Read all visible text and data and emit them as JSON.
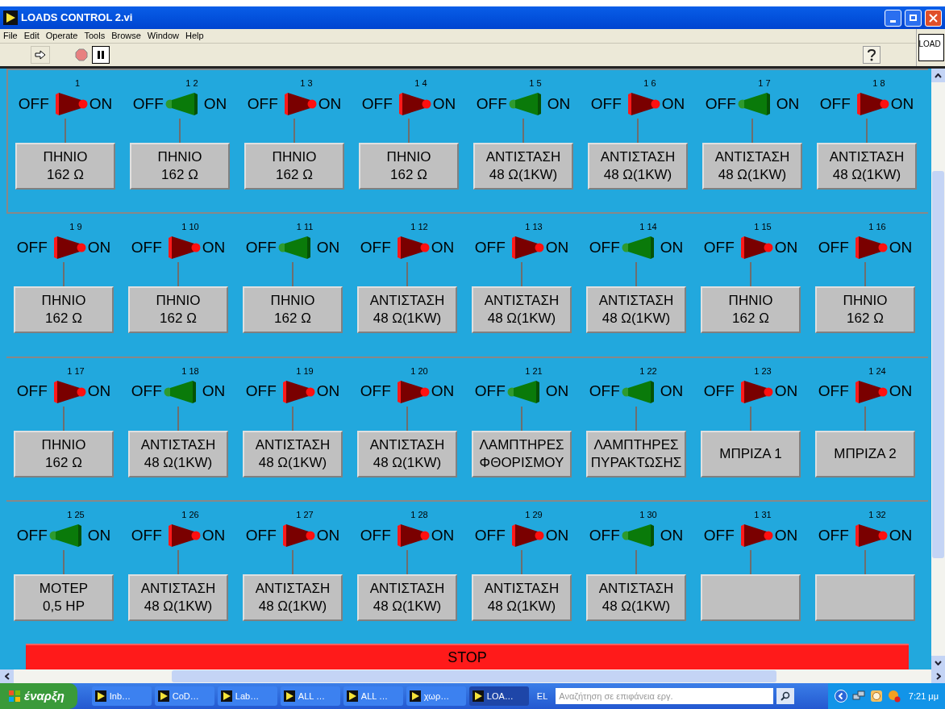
{
  "window": {
    "title": "LOADS CONTROL 2.vi"
  },
  "menu": [
    "File",
    "Edit",
    "Operate",
    "Tools",
    "Browse",
    "Window",
    "Help"
  ],
  "vi_icon": {
    "text": "LOAD"
  },
  "rows": [
    {
      "switches": [
        {
          "number": "1",
          "on": false,
          "off_label": "OFF",
          "on_label": "ON",
          "button": {
            "kind": "text",
            "lines": [
              "ΠΗΝΙΟ",
              "162 Ω"
            ]
          }
        },
        {
          "number": "1 2",
          "on": true,
          "off_label": "OFF",
          "on_label": "ON",
          "button": {
            "kind": "text",
            "lines": [
              "ΠΗΝΙΟ",
              "162 Ω"
            ]
          }
        },
        {
          "number": "1 3",
          "on": false,
          "off_label": "OFF",
          "on_label": "ON",
          "button": {
            "kind": "text",
            "lines": [
              "ΠΗΝΙΟ",
              "162 Ω"
            ]
          }
        },
        {
          "number": "1 4",
          "on": false,
          "off_label": "OFF",
          "on_label": "ON",
          "button": {
            "kind": "text",
            "lines": [
              "ΠΗΝΙΟ",
              "162 Ω"
            ]
          }
        },
        {
          "number": "1 5",
          "on": true,
          "off_label": "OFF",
          "on_label": "ON",
          "button": {
            "kind": "text",
            "lines": [
              "ΑΝΤΙΣΤΑΣΗ",
              "48 Ω(1KW)"
            ]
          }
        },
        {
          "number": "1 6",
          "on": false,
          "off_label": "OFF",
          "on_label": "ON",
          "button": {
            "kind": "text",
            "lines": [
              "ΑΝΤΙΣΤΑΣΗ",
              "48 Ω(1KW)"
            ]
          }
        },
        {
          "number": "1 7",
          "on": true,
          "off_label": "OFF",
          "on_label": "ON",
          "button": {
            "kind": "text",
            "lines": [
              "ΑΝΤΙΣΤΑΣΗ",
              "48 Ω(1KW)"
            ]
          }
        },
        {
          "number": "1 8",
          "on": false,
          "off_label": "OFF",
          "on_label": "ON",
          "button": {
            "kind": "text",
            "lines": [
              "ΑΝΤΙΣΤΑΣΗ",
              "48 Ω(1KW)"
            ]
          }
        }
      ]
    },
    {
      "switches": [
        {
          "number": "1 9",
          "on": false,
          "off_label": "OFF",
          "on_label": "ON",
          "button": {
            "kind": "text",
            "lines": [
              "ΠΗΝΙΟ",
              "162 Ω"
            ]
          }
        },
        {
          "number": "1 10",
          "on": false,
          "off_label": "OFF",
          "on_label": "ON",
          "button": {
            "kind": "text",
            "lines": [
              "ΠΗΝΙΟ",
              "162 Ω"
            ]
          }
        },
        {
          "number": "1 11",
          "on": true,
          "off_label": "OFF",
          "on_label": "ON",
          "button": {
            "kind": "text",
            "lines": [
              "ΠΗΝΙΟ",
              "162 Ω"
            ]
          }
        },
        {
          "number": "1 12",
          "on": false,
          "off_label": "OFF",
          "on_label": "ON",
          "button": {
            "kind": "text",
            "lines": [
              "ΑΝΤΙΣΤΑΣΗ",
              "48 Ω(1KW)"
            ]
          }
        },
        {
          "number": "1 13",
          "on": false,
          "off_label": "OFF",
          "on_label": "ON",
          "button": {
            "kind": "text",
            "lines": [
              "ΑΝΤΙΣΤΑΣΗ",
              "48 Ω(1KW)"
            ]
          }
        },
        {
          "number": "1 14",
          "on": true,
          "off_label": "OFF",
          "on_label": "ON",
          "button": {
            "kind": "text",
            "lines": [
              "ΑΝΤΙΣΤΑΣΗ",
              "48 Ω(1KW)"
            ]
          }
        },
        {
          "number": "1 15",
          "on": false,
          "off_label": "OFF",
          "on_label": "ON",
          "button": {
            "kind": "text",
            "lines": [
              "ΠΗΝΙΟ",
              "162 Ω"
            ]
          }
        },
        {
          "number": "1 16",
          "on": false,
          "off_label": "OFF",
          "on_label": "ON",
          "button": {
            "kind": "text",
            "lines": [
              "ΠΗΝΙΟ",
              "162 Ω"
            ]
          }
        }
      ]
    },
    {
      "switches": [
        {
          "number": "1 17",
          "on": false,
          "off_label": "OFF",
          "on_label": "ON",
          "button": {
            "kind": "text",
            "lines": [
              "ΠΗΝΙΟ",
              "162 Ω"
            ]
          }
        },
        {
          "number": "1 18",
          "on": true,
          "off_label": "OFF",
          "on_label": "ON",
          "button": {
            "kind": "text",
            "lines": [
              "ΑΝΤΙΣΤΑΣΗ",
              "48 Ω(1KW)"
            ]
          }
        },
        {
          "number": "1 19",
          "on": false,
          "off_label": "OFF",
          "on_label": "ON",
          "button": {
            "kind": "text",
            "lines": [
              "ΑΝΤΙΣΤΑΣΗ",
              "48 Ω(1KW)"
            ]
          }
        },
        {
          "number": "1 20",
          "on": false,
          "off_label": "OFF",
          "on_label": "ON",
          "button": {
            "kind": "text",
            "lines": [
              "ΑΝΤΙΣΤΑΣΗ",
              "48 Ω(1KW)"
            ]
          }
        },
        {
          "number": "1 21",
          "on": true,
          "off_label": "OFF",
          "on_label": "ON",
          "button": {
            "kind": "text",
            "lines": [
              "ΛΑΜΠΤΗΡΕΣ",
              "ΦΘΟΡΙΣΜΟΥ"
            ]
          }
        },
        {
          "number": "1 22",
          "on": true,
          "off_label": "OFF",
          "on_label": "ON",
          "button": {
            "kind": "text",
            "lines": [
              "ΛΑΜΠΤΗΡΕΣ",
              "ΠΥΡΑΚΤΩΣΗΣ"
            ]
          }
        },
        {
          "number": "1 23",
          "on": false,
          "off_label": "OFF",
          "on_label": "ON",
          "button": {
            "kind": "text",
            "lines": [
              "ΜΠΡΙΖΑ 1"
            ]
          }
        },
        {
          "number": "1 24",
          "on": false,
          "off_label": "OFF",
          "on_label": "ON",
          "button": {
            "kind": "text",
            "lines": [
              "ΜΠΡΙΖΑ 2"
            ]
          }
        }
      ]
    },
    {
      "switches": [
        {
          "number": "1 25",
          "on": true,
          "off_label": "OFF",
          "on_label": "ON",
          "button": {
            "kind": "text",
            "lines": [
              "ΜΟΤΕΡ",
              "0,5 HP"
            ]
          }
        },
        {
          "number": "1 26",
          "on": false,
          "off_label": "OFF",
          "on_label": "ON",
          "button": {
            "kind": "text",
            "lines": [
              "ΑΝΤΙΣΤΑΣΗ",
              "48 Ω(1KW)"
            ]
          }
        },
        {
          "number": "1 27",
          "on": false,
          "off_label": "OFF",
          "on_label": "ON",
          "button": {
            "kind": "text",
            "lines": [
              "ΑΝΤΙΣΤΑΣΗ",
              "48 Ω(1KW)"
            ]
          }
        },
        {
          "number": "1 28",
          "on": false,
          "off_label": "OFF",
          "on_label": "ON",
          "button": {
            "kind": "text",
            "lines": [
              "ΑΝΤΙΣΤΑΣΗ",
              "48 Ω(1KW)"
            ]
          }
        },
        {
          "number": "1 29",
          "on": false,
          "off_label": "OFF",
          "on_label": "ON",
          "button": {
            "kind": "text",
            "lines": [
              "ΑΝΤΙΣΤΑΣΗ",
              "48 Ω(1KW)"
            ]
          }
        },
        {
          "number": "1 30",
          "on": true,
          "off_label": "OFF",
          "on_label": "ON",
          "button": {
            "kind": "text",
            "lines": [
              "ΑΝΤΙΣΤΑΣΗ",
              "48 Ω(1KW)"
            ]
          }
        },
        {
          "number": "1 31",
          "on": false,
          "off_label": "OFF",
          "on_label": "ON",
          "button": {
            "kind": "blank"
          }
        },
        {
          "number": "1 32",
          "on": false,
          "off_label": "OFF",
          "on_label": "ON",
          "button": {
            "kind": "blank"
          }
        }
      ]
    }
  ],
  "stop_button": {
    "label": "STOP"
  },
  "taskbar": {
    "start": "έναρξη",
    "tasks": [
      {
        "label": "Inb…",
        "selected": false
      },
      {
        "label": "CoD…",
        "selected": false
      },
      {
        "label": "Lab…",
        "selected": false
      },
      {
        "label": "ALL …",
        "selected": false
      },
      {
        "label": "ALL …",
        "selected": false
      },
      {
        "label": "χωρ…",
        "selected": false
      },
      {
        "label": "LOA…",
        "selected": true
      }
    ],
    "language": "EL",
    "search": {
      "placeholder": "Αναζήτηση σε επιφάνεια εργ."
    },
    "clock": "7:21 μμ"
  }
}
